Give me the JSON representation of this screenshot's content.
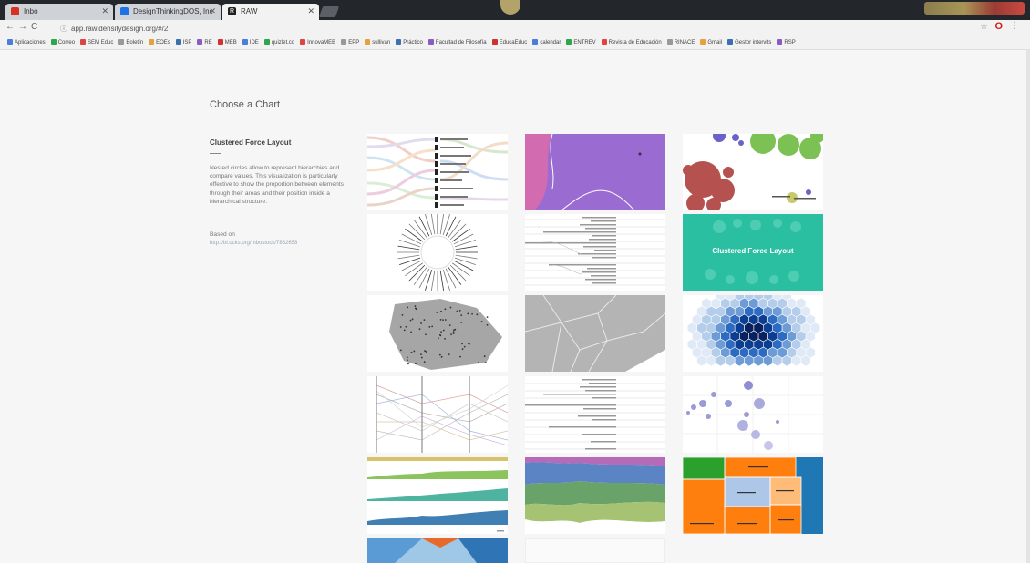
{
  "browser": {
    "tabs": [
      {
        "title": "Inbo",
        "color": "#d93025"
      },
      {
        "title": "DesignThinkingDOS, Inc",
        "color": "#1a73e8"
      },
      {
        "title": "RAW",
        "color": "#222222"
      }
    ],
    "url": "app.raw.densitydesign.org/#/2",
    "bookmarks": [
      "Aplicaciones",
      "Correo",
      "SEM Educ",
      "Boletín",
      "EOEs",
      "ISP",
      "RE",
      "MEB",
      "IDE",
      "quizlet.co",
      "InnovaMEB",
      "EPP",
      "sullivan",
      "Práctico",
      "Facultad de Filosofía",
      "EducaEduc",
      "calendar",
      "ENTREV",
      "Revista de Educación",
      "RINACE",
      "Gmail",
      "Gestor intervits",
      "RSP"
    ]
  },
  "page": {
    "heading": "Choose a Chart",
    "selected": {
      "title": "Clustered Force Layout",
      "description": "Nested circles allow to represent hierarchies and compare values. This visualization is particularly effective to show the proportion between elements through their areas and their position inside a hierarchical structure.",
      "based_on_label": "Based on",
      "based_on_link": "http://bl.ocks.org/mbostock/7882658"
    },
    "charts": [
      {
        "id": "alluvial"
      },
      {
        "id": "area-graph"
      },
      {
        "id": "bubble-chart"
      },
      {
        "id": "circular-dendrogram"
      },
      {
        "id": "cluster-dendrogram"
      },
      {
        "id": "clustered-force-layout",
        "label": "Clustered Force Layout",
        "selected": true
      },
      {
        "id": "convex-hull"
      },
      {
        "id": "voronoi-tessellation"
      },
      {
        "id": "hexagonal-binning"
      },
      {
        "id": "parallel-coordinates"
      },
      {
        "id": "tree-dendrogram"
      },
      {
        "id": "scatter-plot"
      },
      {
        "id": "small-multiples"
      },
      {
        "id": "streamgraph"
      },
      {
        "id": "treemap"
      },
      {
        "id": "pie-partial"
      },
      {
        "id": "blank-partial"
      }
    ]
  },
  "colors": {
    "selected_tile": "#2bbfa1",
    "area_purple": "#a267c6",
    "hex_dark": "#0b2c7a",
    "treemap_orange": "#ff7f0e",
    "treemap_blue": "#1f77b4",
    "treemap_green": "#2ca02c"
  }
}
